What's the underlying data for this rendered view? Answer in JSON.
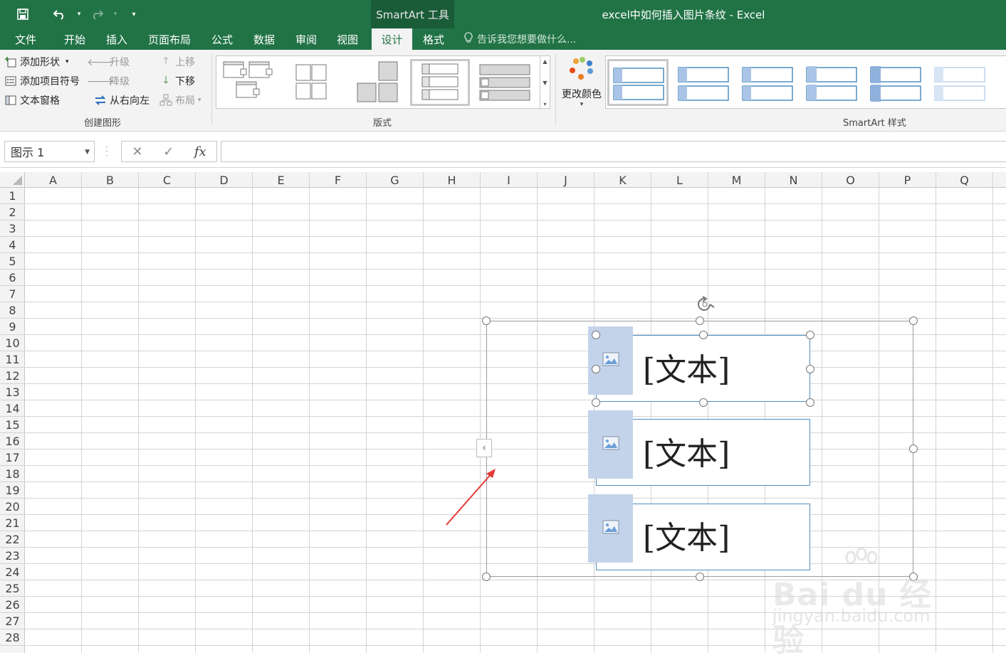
{
  "app": {
    "window_title": "excel中如何插入图片条纹 - Excel",
    "context_tools": "SmartArt 工具"
  },
  "tabs": [
    {
      "label": "文件"
    },
    {
      "label": "开始"
    },
    {
      "label": "插入"
    },
    {
      "label": "页面布局"
    },
    {
      "label": "公式"
    },
    {
      "label": "数据"
    },
    {
      "label": "审阅"
    },
    {
      "label": "视图"
    },
    {
      "label": "设计",
      "active": true
    },
    {
      "label": "格式"
    }
  ],
  "tell_me": "告诉我您想要做什么...",
  "ribbon": {
    "create_graphic": {
      "label": "创建图形",
      "add_shape": "添加形状",
      "add_bullet": "添加项目符号",
      "text_pane": "文本窗格",
      "promote": "升级",
      "demote": "降级",
      "right_to_left": "从右向左",
      "move_up": "上移",
      "move_down": "下移",
      "layout": "布局"
    },
    "layouts": {
      "label": "版式"
    },
    "change_colors": "更改颜色",
    "smartart_styles": {
      "label": "SmartArt 样式"
    }
  },
  "formula_bar": {
    "name_box": "图示 1",
    "fx": "fx",
    "value": ""
  },
  "columns": [
    "A",
    "B",
    "C",
    "D",
    "E",
    "F",
    "G",
    "H",
    "I",
    "J",
    "K",
    "L",
    "M",
    "N",
    "O",
    "P",
    "Q"
  ],
  "rows": [
    "1",
    "2",
    "3",
    "4",
    "5",
    "6",
    "7",
    "8",
    "9",
    "10",
    "11",
    "12",
    "13",
    "14",
    "15",
    "16",
    "17",
    "18",
    "19",
    "20",
    "21",
    "22",
    "23",
    "24",
    "25",
    "26",
    "27",
    "28"
  ],
  "smartart": {
    "items": [
      {
        "text": "[文本]"
      },
      {
        "text": "[文本]"
      },
      {
        "text": "[文本]"
      }
    ]
  },
  "watermark": {
    "logo": "Bai du 经验",
    "url": "jingyan.baidu.com"
  },
  "colors": {
    "excel_green": "#217346",
    "picture_placeholder": "#c3d3ea",
    "shape_border": "#4f8fbf",
    "annotation_arrow": "#e53935"
  }
}
